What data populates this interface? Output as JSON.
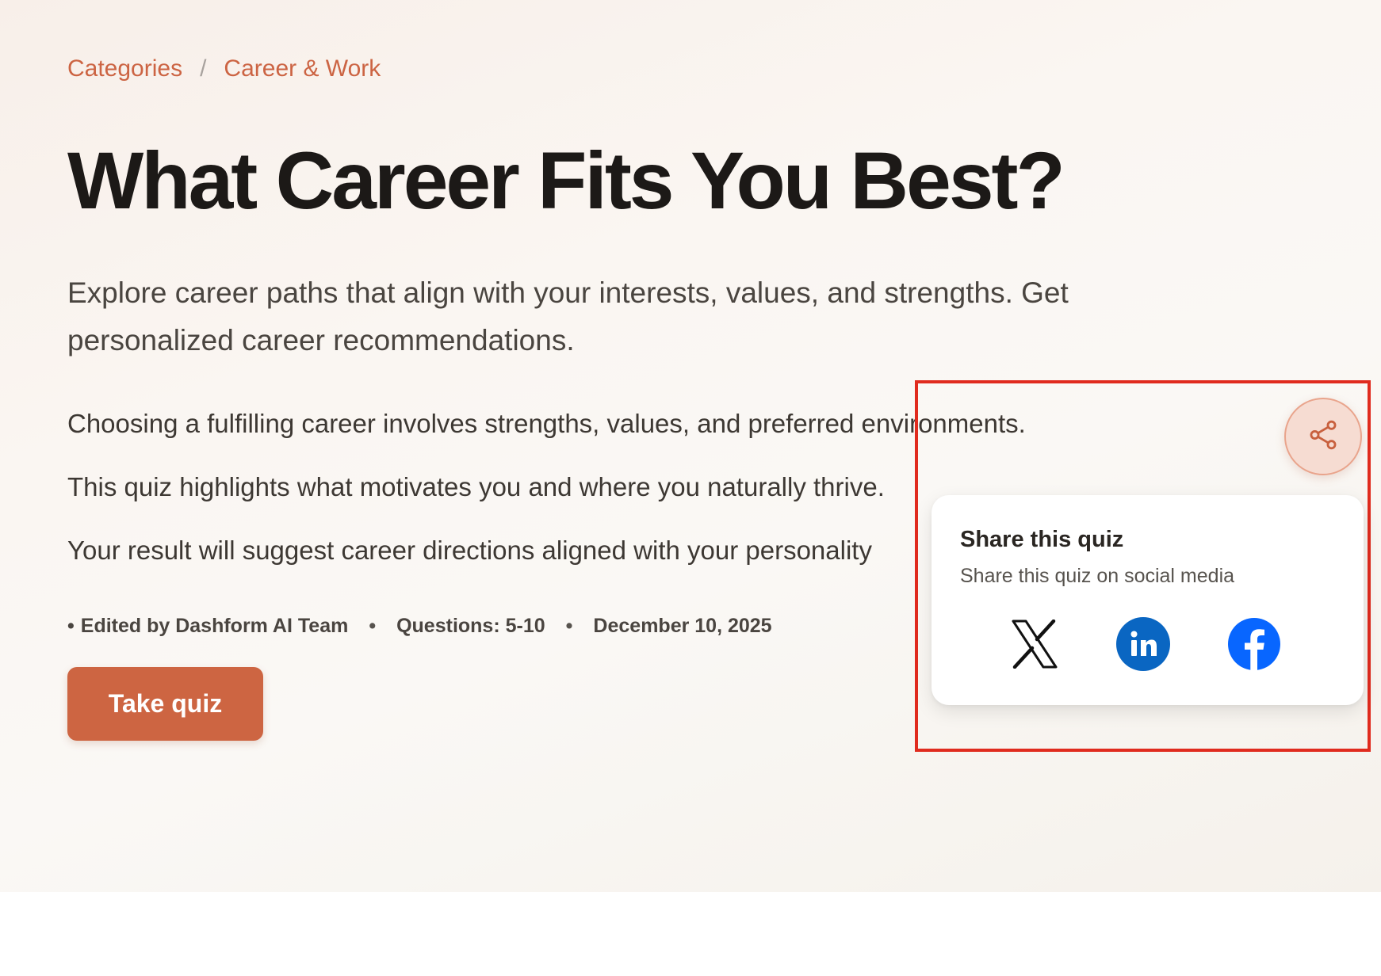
{
  "breadcrumb": {
    "items": [
      "Categories",
      "Career & Work"
    ],
    "separator": "/"
  },
  "hero": {
    "title": "What Career Fits You Best?",
    "lead": "Explore career paths that align with your interests, values, and strengths. Get personalized career recommendations.",
    "paragraphs": [
      "Choosing a fulfilling career involves strengths, values, and preferred environments.",
      "This quiz highlights what motivates you and where you naturally thrive.",
      "Your result will suggest career directions aligned with your personality"
    ],
    "meta": {
      "bullet": "•",
      "editor": "Edited by Dashform AI Team",
      "questions": "Questions: 5-10",
      "date": "December 10, 2025"
    },
    "cta_label": "Take quiz"
  },
  "share": {
    "button_icon": "share-icon",
    "title": "Share this quiz",
    "subtitle": "Share this quiz on social media",
    "networks": [
      {
        "name": "X",
        "icon": "x-logo-icon"
      },
      {
        "name": "LinkedIn",
        "icon": "linkedin-logo-icon"
      },
      {
        "name": "Facebook",
        "icon": "facebook-logo-icon"
      }
    ]
  },
  "colors": {
    "accent": "#cd6542",
    "highlight_border": "#e02b1e",
    "linkedin": "#0a66c2",
    "facebook": "#0866ff"
  }
}
